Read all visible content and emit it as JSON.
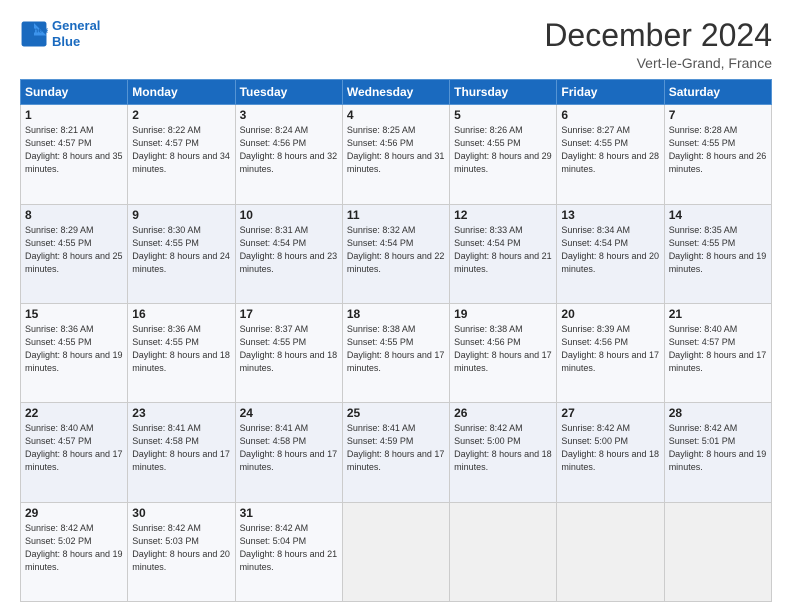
{
  "logo": {
    "line1": "General",
    "line2": "Blue"
  },
  "title": "December 2024",
  "subtitle": "Vert-le-Grand, France",
  "days_header": [
    "Sunday",
    "Monday",
    "Tuesday",
    "Wednesday",
    "Thursday",
    "Friday",
    "Saturday"
  ],
  "weeks": [
    [
      {
        "day": "1",
        "sunrise": "8:21 AM",
        "sunset": "4:57 PM",
        "daylight": "8 hours and 35 minutes."
      },
      {
        "day": "2",
        "sunrise": "8:22 AM",
        "sunset": "4:57 PM",
        "daylight": "8 hours and 34 minutes."
      },
      {
        "day": "3",
        "sunrise": "8:24 AM",
        "sunset": "4:56 PM",
        "daylight": "8 hours and 32 minutes."
      },
      {
        "day": "4",
        "sunrise": "8:25 AM",
        "sunset": "4:56 PM",
        "daylight": "8 hours and 31 minutes."
      },
      {
        "day": "5",
        "sunrise": "8:26 AM",
        "sunset": "4:55 PM",
        "daylight": "8 hours and 29 minutes."
      },
      {
        "day": "6",
        "sunrise": "8:27 AM",
        "sunset": "4:55 PM",
        "daylight": "8 hours and 28 minutes."
      },
      {
        "day": "7",
        "sunrise": "8:28 AM",
        "sunset": "4:55 PM",
        "daylight": "8 hours and 26 minutes."
      }
    ],
    [
      {
        "day": "8",
        "sunrise": "8:29 AM",
        "sunset": "4:55 PM",
        "daylight": "8 hours and 25 minutes."
      },
      {
        "day": "9",
        "sunrise": "8:30 AM",
        "sunset": "4:55 PM",
        "daylight": "8 hours and 24 minutes."
      },
      {
        "day": "10",
        "sunrise": "8:31 AM",
        "sunset": "4:54 PM",
        "daylight": "8 hours and 23 minutes."
      },
      {
        "day": "11",
        "sunrise": "8:32 AM",
        "sunset": "4:54 PM",
        "daylight": "8 hours and 22 minutes."
      },
      {
        "day": "12",
        "sunrise": "8:33 AM",
        "sunset": "4:54 PM",
        "daylight": "8 hours and 21 minutes."
      },
      {
        "day": "13",
        "sunrise": "8:34 AM",
        "sunset": "4:54 PM",
        "daylight": "8 hours and 20 minutes."
      },
      {
        "day": "14",
        "sunrise": "8:35 AM",
        "sunset": "4:55 PM",
        "daylight": "8 hours and 19 minutes."
      }
    ],
    [
      {
        "day": "15",
        "sunrise": "8:36 AM",
        "sunset": "4:55 PM",
        "daylight": "8 hours and 19 minutes."
      },
      {
        "day": "16",
        "sunrise": "8:36 AM",
        "sunset": "4:55 PM",
        "daylight": "8 hours and 18 minutes."
      },
      {
        "day": "17",
        "sunrise": "8:37 AM",
        "sunset": "4:55 PM",
        "daylight": "8 hours and 18 minutes."
      },
      {
        "day": "18",
        "sunrise": "8:38 AM",
        "sunset": "4:55 PM",
        "daylight": "8 hours and 17 minutes."
      },
      {
        "day": "19",
        "sunrise": "8:38 AM",
        "sunset": "4:56 PM",
        "daylight": "8 hours and 17 minutes."
      },
      {
        "day": "20",
        "sunrise": "8:39 AM",
        "sunset": "4:56 PM",
        "daylight": "8 hours and 17 minutes."
      },
      {
        "day": "21",
        "sunrise": "8:40 AM",
        "sunset": "4:57 PM",
        "daylight": "8 hours and 17 minutes."
      }
    ],
    [
      {
        "day": "22",
        "sunrise": "8:40 AM",
        "sunset": "4:57 PM",
        "daylight": "8 hours and 17 minutes."
      },
      {
        "day": "23",
        "sunrise": "8:41 AM",
        "sunset": "4:58 PM",
        "daylight": "8 hours and 17 minutes."
      },
      {
        "day": "24",
        "sunrise": "8:41 AM",
        "sunset": "4:58 PM",
        "daylight": "8 hours and 17 minutes."
      },
      {
        "day": "25",
        "sunrise": "8:41 AM",
        "sunset": "4:59 PM",
        "daylight": "8 hours and 17 minutes."
      },
      {
        "day": "26",
        "sunrise": "8:42 AM",
        "sunset": "5:00 PM",
        "daylight": "8 hours and 18 minutes."
      },
      {
        "day": "27",
        "sunrise": "8:42 AM",
        "sunset": "5:00 PM",
        "daylight": "8 hours and 18 minutes."
      },
      {
        "day": "28",
        "sunrise": "8:42 AM",
        "sunset": "5:01 PM",
        "daylight": "8 hours and 19 minutes."
      }
    ],
    [
      {
        "day": "29",
        "sunrise": "8:42 AM",
        "sunset": "5:02 PM",
        "daylight": "8 hours and 19 minutes."
      },
      {
        "day": "30",
        "sunrise": "8:42 AM",
        "sunset": "5:03 PM",
        "daylight": "8 hours and 20 minutes."
      },
      {
        "day": "31",
        "sunrise": "8:42 AM",
        "sunset": "5:04 PM",
        "daylight": "8 hours and 21 minutes."
      },
      null,
      null,
      null,
      null
    ]
  ]
}
